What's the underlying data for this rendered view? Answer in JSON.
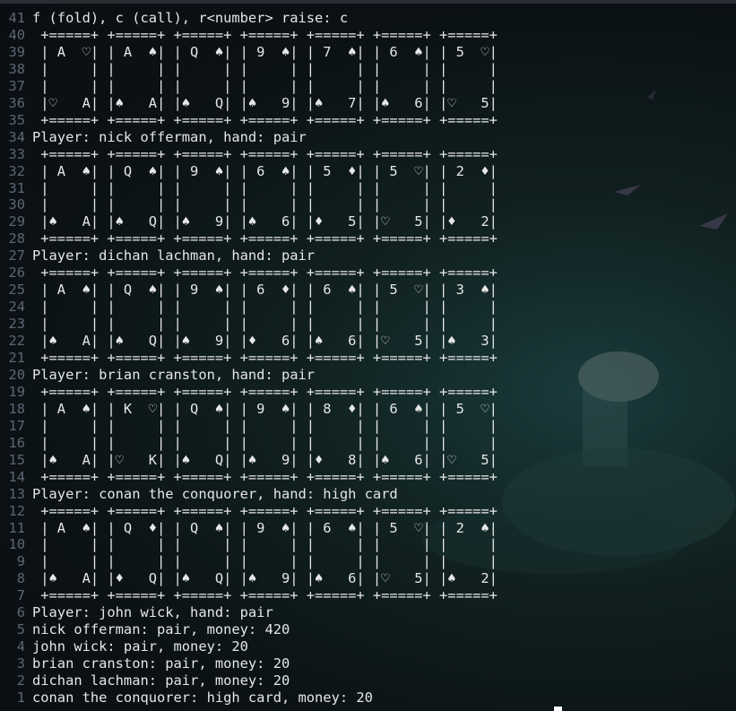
{
  "terminal": {
    "lines": [
      {
        "n": "41",
        "t": "f (fold), c (call), r<number> raise: c"
      },
      {
        "n": "40",
        "t": " +=====+ +=====+ +=====+ +=====+ +=====+ +=====+ +=====+"
      },
      {
        "n": "39",
        "t": " | A  ♡| | A  ♠| | Q  ♠| | 9  ♠| | 7  ♠| | 6  ♠| | 5  ♡|"
      },
      {
        "n": "38",
        "t": " |     | |     | |     | |     | |     | |     | |     |"
      },
      {
        "n": "37",
        "t": " |     | |     | |     | |     | |     | |     | |     |"
      },
      {
        "n": "36",
        "t": " |♡   A| |♠   A| |♠   Q| |♠   9| |♠   7| |♠   6| |♡   5|"
      },
      {
        "n": "35",
        "t": " +=====+ +=====+ +=====+ +=====+ +=====+ +=====+ +=====+"
      },
      {
        "n": "34",
        "t": "Player: nick offerman, hand: pair"
      },
      {
        "n": "33",
        "t": " +=====+ +=====+ +=====+ +=====+ +=====+ +=====+ +=====+"
      },
      {
        "n": "32",
        "t": " | A  ♠| | Q  ♠| | 9  ♠| | 6  ♠| | 5  ♦| | 5  ♡| | 2  ♦|"
      },
      {
        "n": "31",
        "t": " |     | |     | |     | |     | |     | |     | |     |"
      },
      {
        "n": "30",
        "t": " |     | |     | |     | |     | |     | |     | |     |"
      },
      {
        "n": "29",
        "t": " |♠   A| |♠   Q| |♠   9| |♠   6| |♦   5| |♡   5| |♦   2|"
      },
      {
        "n": "28",
        "t": " +=====+ +=====+ +=====+ +=====+ +=====+ +=====+ +=====+"
      },
      {
        "n": "27",
        "t": "Player: dichan lachman, hand: pair"
      },
      {
        "n": "26",
        "t": " +=====+ +=====+ +=====+ +=====+ +=====+ +=====+ +=====+"
      },
      {
        "n": "25",
        "t": " | A  ♠| | Q  ♠| | 9  ♠| | 6  ♦| | 6  ♠| | 5  ♡| | 3  ♠|"
      },
      {
        "n": "24",
        "t": " |     | |     | |     | |     | |     | |     | |     |"
      },
      {
        "n": "23",
        "t": " |     | |     | |     | |     | |     | |     | |     |"
      },
      {
        "n": "22",
        "t": " |♠   A| |♠   Q| |♠   9| |♦   6| |♠   6| |♡   5| |♠   3|"
      },
      {
        "n": "21",
        "t": " +=====+ +=====+ +=====+ +=====+ +=====+ +=====+ +=====+"
      },
      {
        "n": "20",
        "t": "Player: brian cranston, hand: pair"
      },
      {
        "n": "19",
        "t": " +=====+ +=====+ +=====+ +=====+ +=====+ +=====+ +=====+"
      },
      {
        "n": "18",
        "t": " | A  ♠| | K  ♡| | Q  ♠| | 9  ♠| | 8  ♦| | 6  ♠| | 5  ♡|"
      },
      {
        "n": "17",
        "t": " |     | |     | |     | |     | |     | |     | |     |"
      },
      {
        "n": "16",
        "t": " |     | |     | |     | |     | |     | |     | |     |"
      },
      {
        "n": "15",
        "t": " |♠   A| |♡   K| |♠   Q| |♠   9| |♦   8| |♠   6| |♡   5|"
      },
      {
        "n": "14",
        "t": " +=====+ +=====+ +=====+ +=====+ +=====+ +=====+ +=====+"
      },
      {
        "n": "13",
        "t": "Player: conan the conquorer, hand: high card"
      },
      {
        "n": "12",
        "t": " +=====+ +=====+ +=====+ +=====+ +=====+ +=====+ +=====+"
      },
      {
        "n": "11",
        "t": " | A  ♠| | Q  ♦| | Q  ♠| | 9  ♠| | 6  ♠| | 5  ♡| | 2  ♠|"
      },
      {
        "n": "10",
        "t": " |     | |     | |     | |     | |     | |     | |     |"
      },
      {
        "n": "9",
        "t": " |     | |     | |     | |     | |     | |     | |     |"
      },
      {
        "n": "8",
        "t": " |♠   A| |♦   Q| |♠   Q| |♠   9| |♠   6| |♡   5| |♠   2|"
      },
      {
        "n": "7",
        "t": " +=====+ +=====+ +=====+ +=====+ +=====+ +=====+ +=====+"
      },
      {
        "n": "6",
        "t": "Player: john wick, hand: pair"
      },
      {
        "n": "5",
        "t": "nick offerman: pair, money: 420"
      },
      {
        "n": "4",
        "t": "john wick: pair, money: 20"
      },
      {
        "n": "3",
        "t": "brian cranston: pair, money: 20"
      },
      {
        "n": "2",
        "t": "dichan lachman: pair, money: 20"
      },
      {
        "n": "1",
        "t": "conan the conquorer: high card, money: 20"
      }
    ]
  },
  "colors": {
    "background": "#0a0e12",
    "text": "#e6e6e6",
    "line_numbers": "#5f6675",
    "teal_glow": "#1a3a3c"
  }
}
